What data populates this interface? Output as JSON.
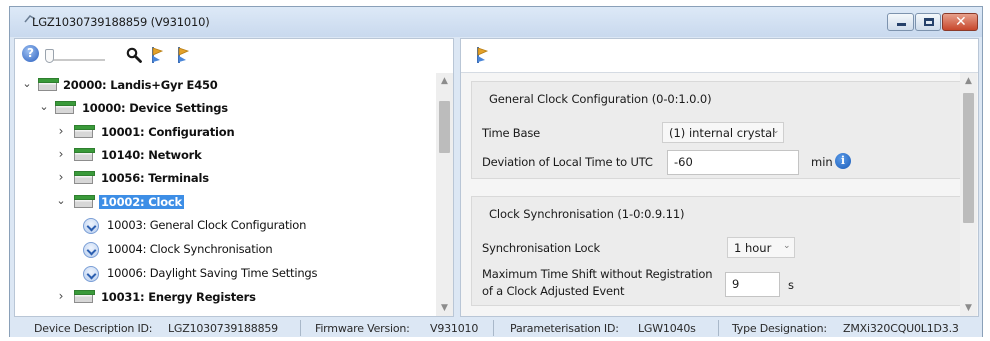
{
  "window": {
    "title": "LGZ1030739188859 (V931010)"
  },
  "toolbar": {
    "help_icon": "help-icon",
    "help_glyph": "?",
    "search_icon": "search-icon",
    "pin_icons": [
      "pin-icon",
      "pin-icon"
    ]
  },
  "tree": {
    "items": [
      {
        "label": "20000: Landis+Gyr E450",
        "expanded": true,
        "kind": "folder",
        "bold": true
      },
      {
        "label": "10000: Device Settings",
        "expanded": true,
        "kind": "folder",
        "bold": true
      },
      {
        "label": "10001: Configuration",
        "expanded": false,
        "kind": "folder",
        "bold": true
      },
      {
        "label": "10140: Network",
        "expanded": false,
        "kind": "folder",
        "bold": true
      },
      {
        "label": "10056: Terminals",
        "expanded": false,
        "kind": "folder",
        "bold": true
      },
      {
        "label": "10002: Clock",
        "expanded": true,
        "kind": "folder",
        "bold": true,
        "selected": true
      },
      {
        "label": "10003: General Clock Configuration",
        "kind": "page",
        "bold": false
      },
      {
        "label": "10004: Clock Synchronisation",
        "kind": "page",
        "bold": false
      },
      {
        "label": "10006: Daylight Saving Time Settings",
        "kind": "page",
        "bold": false
      },
      {
        "label": "10031: Energy Registers",
        "expanded": false,
        "kind": "folder",
        "bold": true
      }
    ]
  },
  "details": {
    "general_clock": {
      "title": "General Clock Configuration (0-0:1.0.0)",
      "time_base_label": "Time Base",
      "time_base_value": "(1) internal crystal",
      "deviation_label": "Deviation of Local Time to UTC",
      "deviation_value": "-60",
      "deviation_unit": "min"
    },
    "clock_sync": {
      "title": "Clock Synchronisation (1-0:0.9.11)",
      "sync_lock_label": "Synchronisation Lock",
      "sync_lock_value": "1 hour",
      "max_shift_label_line1": "Maximum Time Shift without Registration",
      "max_shift_label_line2": "of a Clock Adjusted Event",
      "max_shift_value": "9",
      "max_shift_unit": "s"
    }
  },
  "status": {
    "device_desc_label": "Device Description ID:",
    "device_desc_value": "LGZ1030739188859",
    "firmware_label": "Firmware Version:",
    "firmware_value": "V931010",
    "param_label": "Parameterisation ID:",
    "param_value": "LGW1040s",
    "type_label": "Type Designation:",
    "type_value": "ZMXi320CQU0L1D3.3"
  },
  "colors": {
    "selection": "#3d8ee6",
    "folder_green": "#3a9a3a",
    "close_red": "#c7472c",
    "info_blue": "#1b5bb8"
  }
}
